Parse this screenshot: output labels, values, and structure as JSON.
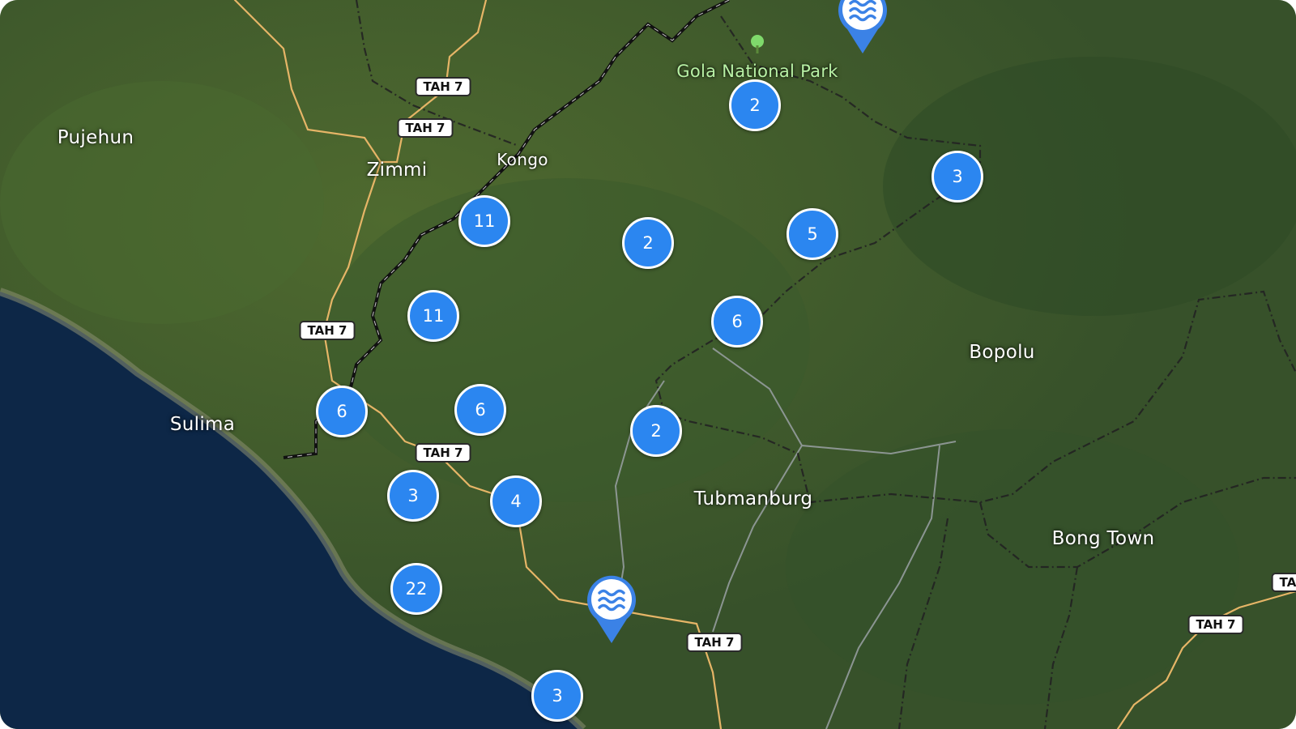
{
  "map": {
    "places": [
      {
        "id": "pujehun",
        "label": "Pujehun"
      },
      {
        "id": "zimmi",
        "label": "Zimmi"
      },
      {
        "id": "kongo",
        "label": "Kongo"
      },
      {
        "id": "gola",
        "label": "Gola National Park"
      },
      {
        "id": "sulima",
        "label": "Sulima"
      },
      {
        "id": "bopolu",
        "label": "Bopolu"
      },
      {
        "id": "tubmanburg",
        "label": "Tubmanburg"
      },
      {
        "id": "bong-town",
        "label": "Bong Town"
      }
    ],
    "road_shields": [
      {
        "id": "s1",
        "label": "TAH 7"
      },
      {
        "id": "s2",
        "label": "TAH 7"
      },
      {
        "id": "s3",
        "label": "TAH 7"
      },
      {
        "id": "s4",
        "label": "TAH 7"
      },
      {
        "id": "s5",
        "label": "TAH 7"
      },
      {
        "id": "s6",
        "label": "TAH 7"
      },
      {
        "id": "s7",
        "label": "TA"
      }
    ],
    "clusters": [
      {
        "id": "c1",
        "count": "2"
      },
      {
        "id": "c2",
        "count": "3"
      },
      {
        "id": "c3",
        "count": "11"
      },
      {
        "id": "c4",
        "count": "2"
      },
      {
        "id": "c5",
        "count": "5"
      },
      {
        "id": "c6",
        "count": "11"
      },
      {
        "id": "c7",
        "count": "6"
      },
      {
        "id": "c8",
        "count": "6"
      },
      {
        "id": "c9",
        "count": "6"
      },
      {
        "id": "c10",
        "count": "2"
      },
      {
        "id": "c11",
        "count": "3"
      },
      {
        "id": "c12",
        "count": "4"
      },
      {
        "id": "c13",
        "count": "22"
      },
      {
        "id": "c14",
        "count": "3"
      }
    ],
    "pins": [
      {
        "id": "pin-top",
        "icon": "water-waves-icon"
      },
      {
        "id": "pin-bottom",
        "icon": "water-waves-icon"
      }
    ],
    "colors": {
      "cluster": "#2b86f0",
      "pin": "#3b82e6",
      "ocean": "#0d2747",
      "land": "#3f5a2a",
      "road": "#e6b567",
      "border": "#111111",
      "park_label": "#b9f2a6"
    }
  }
}
